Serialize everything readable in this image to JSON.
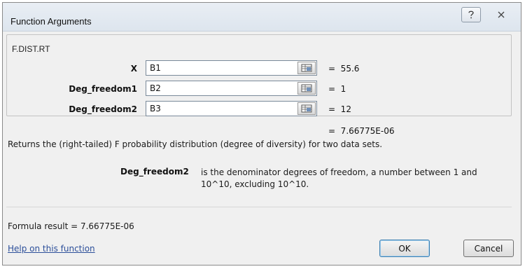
{
  "window": {
    "title": "Function Arguments"
  },
  "group": {
    "label": "F.DIST.RT"
  },
  "arguments": [
    {
      "label": "X",
      "value": "B1",
      "result": "=  55.6"
    },
    {
      "label": "Deg_freedom1",
      "value": "B2",
      "result": "=  1"
    },
    {
      "label": "Deg_freedom2",
      "value": "B3",
      "result": "=  12"
    }
  ],
  "function_result": "=  7.66775E-06",
  "description": "Returns the (right-tailed) F probability distribution (degree of diversity) for two data sets.",
  "arg_help": {
    "name": "Deg_freedom2",
    "text": "is the denominator degrees of freedom, a number between 1 and 10^10, excluding 10^10."
  },
  "formula_result": "Formula result =  7.66775E-06",
  "help_link": "Help on this function",
  "buttons": {
    "ok": "OK",
    "cancel": "Cancel"
  }
}
